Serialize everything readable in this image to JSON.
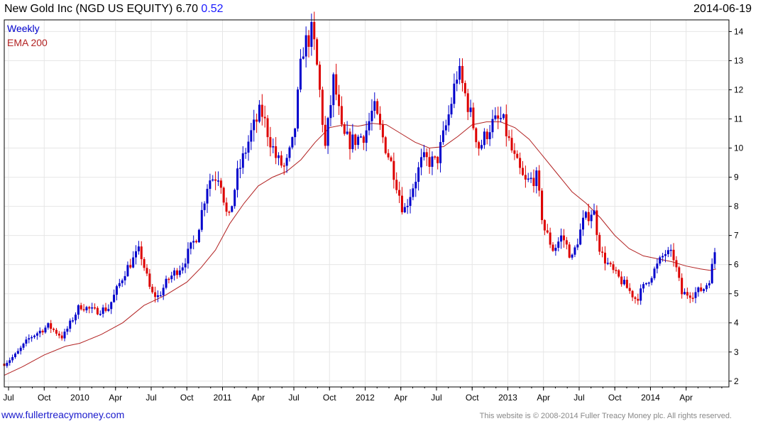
{
  "header": {
    "title": "New Gold Inc (NGD US EQUITY)",
    "last": "6.70",
    "change": "0.52",
    "date": "2014-06-19"
  },
  "footer": {
    "link": "www.fullertreacymoney.com",
    "copyright": "This website is © 2008-2014 Fuller Treacy Money plc. All rights reserved."
  },
  "colors": {
    "up": "#0000cc",
    "down": "#dd0000",
    "ema": "#b22222",
    "grid": "#e6e6e6",
    "axis": "#000000"
  },
  "chart_data": {
    "type": "line",
    "frequency_label": "Weekly",
    "ylim": [
      1.8,
      14.4
    ],
    "yticks": [
      2,
      3,
      4,
      5,
      6,
      7,
      8,
      9,
      10,
      11,
      12,
      13,
      14
    ],
    "xlim": [
      2009.47,
      2014.55
    ],
    "xticks": [
      {
        "label": "Jul",
        "t": 2009.5
      },
      {
        "label": "Oct",
        "t": 2009.75
      },
      {
        "label": "2010",
        "t": 2010.0
      },
      {
        "label": "Apr",
        "t": 2010.25
      },
      {
        "label": "Jul",
        "t": 2010.5
      },
      {
        "label": "Oct",
        "t": 2010.75
      },
      {
        "label": "2011",
        "t": 2011.0
      },
      {
        "label": "Apr",
        "t": 2011.25
      },
      {
        "label": "Jul",
        "t": 2011.5
      },
      {
        "label": "Oct",
        "t": 2011.75
      },
      {
        "label": "2012",
        "t": 2012.0
      },
      {
        "label": "Apr",
        "t": 2012.25
      },
      {
        "label": "Jul",
        "t": 2012.5
      },
      {
        "label": "Oct",
        "t": 2012.75
      },
      {
        "label": "2013",
        "t": 2013.0
      },
      {
        "label": "Apr",
        "t": 2013.25
      },
      {
        "label": "Jul",
        "t": 2013.5
      },
      {
        "label": "Oct",
        "t": 2013.75
      },
      {
        "label": "2014",
        "t": 2014.0
      },
      {
        "label": "Apr",
        "t": 2014.25
      }
    ],
    "price_path": [
      [
        2009.47,
        2.6
      ],
      [
        2009.55,
        2.9
      ],
      [
        2009.65,
        3.5
      ],
      [
        2009.78,
        3.9
      ],
      [
        2009.88,
        3.5
      ],
      [
        2010.0,
        4.6
      ],
      [
        2010.1,
        4.4
      ],
      [
        2010.2,
        4.5
      ],
      [
        2010.32,
        5.8
      ],
      [
        2010.42,
        6.5
      ],
      [
        2010.5,
        5.0
      ],
      [
        2010.55,
        4.9
      ],
      [
        2010.62,
        5.5
      ],
      [
        2010.72,
        6.0
      ],
      [
        2010.82,
        7.0
      ],
      [
        2010.9,
        8.9
      ],
      [
        2010.98,
        9.1
      ],
      [
        2011.04,
        7.4
      ],
      [
        2011.1,
        9.0
      ],
      [
        2011.2,
        10.5
      ],
      [
        2011.27,
        11.3
      ],
      [
        2011.32,
        10.5
      ],
      [
        2011.38,
        9.6
      ],
      [
        2011.44,
        9.3
      ],
      [
        2011.5,
        10.3
      ],
      [
        2011.56,
        13.4
      ],
      [
        2011.63,
        14.0
      ],
      [
        2011.67,
        12.5
      ],
      [
        2011.72,
        10.0
      ],
      [
        2011.78,
        12.4
      ],
      [
        2011.84,
        10.4
      ],
      [
        2011.9,
        10.2
      ],
      [
        2012.0,
        10.5
      ],
      [
        2012.06,
        11.4
      ],
      [
        2012.12,
        10.4
      ],
      [
        2012.2,
        9.2
      ],
      [
        2012.27,
        7.8
      ],
      [
        2012.32,
        8.5
      ],
      [
        2012.4,
        9.6
      ],
      [
        2012.5,
        9.5
      ],
      [
        2012.58,
        11.0
      ],
      [
        2012.65,
        12.7
      ],
      [
        2012.72,
        11.5
      ],
      [
        2012.8,
        10.0
      ],
      [
        2012.88,
        10.8
      ],
      [
        2012.96,
        11.0
      ],
      [
        2013.04,
        9.7
      ],
      [
        2013.12,
        8.8
      ],
      [
        2013.2,
        9.0
      ],
      [
        2013.25,
        7.3
      ],
      [
        2013.32,
        6.5
      ],
      [
        2013.38,
        7.0
      ],
      [
        2013.45,
        6.2
      ],
      [
        2013.53,
        7.5
      ],
      [
        2013.6,
        7.9
      ],
      [
        2013.65,
        6.4
      ],
      [
        2013.73,
        5.8
      ],
      [
        2013.82,
        5.3
      ],
      [
        2013.9,
        4.8
      ],
      [
        2013.96,
        5.3
      ],
      [
        2014.04,
        5.9
      ],
      [
        2014.1,
        6.4
      ],
      [
        2014.16,
        6.3
      ],
      [
        2014.22,
        5.0
      ],
      [
        2014.3,
        5.0
      ],
      [
        2014.38,
        5.2
      ],
      [
        2014.42,
        5.6
      ],
      [
        2014.46,
        6.7
      ]
    ],
    "ema_200": [
      [
        2009.47,
        2.2
      ],
      [
        2009.6,
        2.5
      ],
      [
        2009.75,
        2.9
      ],
      [
        2009.9,
        3.2
      ],
      [
        2010.0,
        3.3
      ],
      [
        2010.15,
        3.6
      ],
      [
        2010.3,
        4.0
      ],
      [
        2010.45,
        4.6
      ],
      [
        2010.6,
        4.95
      ],
      [
        2010.75,
        5.4
      ],
      [
        2010.85,
        5.9
      ],
      [
        2010.95,
        6.5
      ],
      [
        2011.05,
        7.4
      ],
      [
        2011.15,
        8.1
      ],
      [
        2011.25,
        8.7
      ],
      [
        2011.35,
        9.0
      ],
      [
        2011.45,
        9.2
      ],
      [
        2011.55,
        9.6
      ],
      [
        2011.65,
        10.2
      ],
      [
        2011.75,
        10.7
      ],
      [
        2011.85,
        10.8
      ],
      [
        2011.95,
        10.75
      ],
      [
        2012.05,
        10.85
      ],
      [
        2012.15,
        10.8
      ],
      [
        2012.25,
        10.5
      ],
      [
        2012.35,
        10.2
      ],
      [
        2012.45,
        10.0
      ],
      [
        2012.55,
        10.05
      ],
      [
        2012.65,
        10.4
      ],
      [
        2012.75,
        10.8
      ],
      [
        2012.85,
        10.9
      ],
      [
        2012.95,
        10.9
      ],
      [
        2013.05,
        10.7
      ],
      [
        2013.15,
        10.3
      ],
      [
        2013.25,
        9.7
      ],
      [
        2013.35,
        9.1
      ],
      [
        2013.45,
        8.5
      ],
      [
        2013.55,
        8.1
      ],
      [
        2013.65,
        7.6
      ],
      [
        2013.75,
        7.0
      ],
      [
        2013.85,
        6.55
      ],
      [
        2013.95,
        6.3
      ],
      [
        2014.05,
        6.2
      ],
      [
        2014.15,
        6.1
      ],
      [
        2014.25,
        5.95
      ],
      [
        2014.35,
        5.85
      ],
      [
        2014.42,
        5.8
      ],
      [
        2014.46,
        5.85
      ]
    ],
    "series": [
      {
        "name": "Weekly",
        "color": "#0000cc"
      },
      {
        "name": "EMA 200",
        "color": "#b22222"
      }
    ],
    "right_axis": true,
    "legend_placement": "top-left",
    "grid": true
  }
}
